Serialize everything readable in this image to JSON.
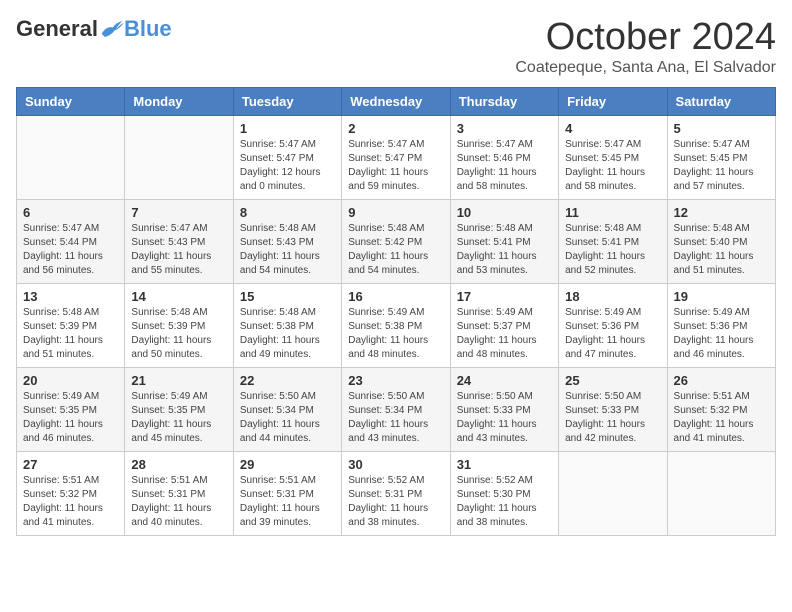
{
  "header": {
    "logo_general": "General",
    "logo_blue": "Blue",
    "month_title": "October 2024",
    "location": "Coatepeque, Santa Ana, El Salvador"
  },
  "days_of_week": [
    "Sunday",
    "Monday",
    "Tuesday",
    "Wednesday",
    "Thursday",
    "Friday",
    "Saturday"
  ],
  "weeks": [
    [
      {
        "day": "",
        "sunrise": "",
        "sunset": "",
        "daylight": ""
      },
      {
        "day": "",
        "sunrise": "",
        "sunset": "",
        "daylight": ""
      },
      {
        "day": "1",
        "sunrise": "Sunrise: 5:47 AM",
        "sunset": "Sunset: 5:47 PM",
        "daylight": "Daylight: 12 hours and 0 minutes."
      },
      {
        "day": "2",
        "sunrise": "Sunrise: 5:47 AM",
        "sunset": "Sunset: 5:47 PM",
        "daylight": "Daylight: 11 hours and 59 minutes."
      },
      {
        "day": "3",
        "sunrise": "Sunrise: 5:47 AM",
        "sunset": "Sunset: 5:46 PM",
        "daylight": "Daylight: 11 hours and 58 minutes."
      },
      {
        "day": "4",
        "sunrise": "Sunrise: 5:47 AM",
        "sunset": "Sunset: 5:45 PM",
        "daylight": "Daylight: 11 hours and 58 minutes."
      },
      {
        "day": "5",
        "sunrise": "Sunrise: 5:47 AM",
        "sunset": "Sunset: 5:45 PM",
        "daylight": "Daylight: 11 hours and 57 minutes."
      }
    ],
    [
      {
        "day": "6",
        "sunrise": "Sunrise: 5:47 AM",
        "sunset": "Sunset: 5:44 PM",
        "daylight": "Daylight: 11 hours and 56 minutes."
      },
      {
        "day": "7",
        "sunrise": "Sunrise: 5:47 AM",
        "sunset": "Sunset: 5:43 PM",
        "daylight": "Daylight: 11 hours and 55 minutes."
      },
      {
        "day": "8",
        "sunrise": "Sunrise: 5:48 AM",
        "sunset": "Sunset: 5:43 PM",
        "daylight": "Daylight: 11 hours and 54 minutes."
      },
      {
        "day": "9",
        "sunrise": "Sunrise: 5:48 AM",
        "sunset": "Sunset: 5:42 PM",
        "daylight": "Daylight: 11 hours and 54 minutes."
      },
      {
        "day": "10",
        "sunrise": "Sunrise: 5:48 AM",
        "sunset": "Sunset: 5:41 PM",
        "daylight": "Daylight: 11 hours and 53 minutes."
      },
      {
        "day": "11",
        "sunrise": "Sunrise: 5:48 AM",
        "sunset": "Sunset: 5:41 PM",
        "daylight": "Daylight: 11 hours and 52 minutes."
      },
      {
        "day": "12",
        "sunrise": "Sunrise: 5:48 AM",
        "sunset": "Sunset: 5:40 PM",
        "daylight": "Daylight: 11 hours and 51 minutes."
      }
    ],
    [
      {
        "day": "13",
        "sunrise": "Sunrise: 5:48 AM",
        "sunset": "Sunset: 5:39 PM",
        "daylight": "Daylight: 11 hours and 51 minutes."
      },
      {
        "day": "14",
        "sunrise": "Sunrise: 5:48 AM",
        "sunset": "Sunset: 5:39 PM",
        "daylight": "Daylight: 11 hours and 50 minutes."
      },
      {
        "day": "15",
        "sunrise": "Sunrise: 5:48 AM",
        "sunset": "Sunset: 5:38 PM",
        "daylight": "Daylight: 11 hours and 49 minutes."
      },
      {
        "day": "16",
        "sunrise": "Sunrise: 5:49 AM",
        "sunset": "Sunset: 5:38 PM",
        "daylight": "Daylight: 11 hours and 48 minutes."
      },
      {
        "day": "17",
        "sunrise": "Sunrise: 5:49 AM",
        "sunset": "Sunset: 5:37 PM",
        "daylight": "Daylight: 11 hours and 48 minutes."
      },
      {
        "day": "18",
        "sunrise": "Sunrise: 5:49 AM",
        "sunset": "Sunset: 5:36 PM",
        "daylight": "Daylight: 11 hours and 47 minutes."
      },
      {
        "day": "19",
        "sunrise": "Sunrise: 5:49 AM",
        "sunset": "Sunset: 5:36 PM",
        "daylight": "Daylight: 11 hours and 46 minutes."
      }
    ],
    [
      {
        "day": "20",
        "sunrise": "Sunrise: 5:49 AM",
        "sunset": "Sunset: 5:35 PM",
        "daylight": "Daylight: 11 hours and 46 minutes."
      },
      {
        "day": "21",
        "sunrise": "Sunrise: 5:49 AM",
        "sunset": "Sunset: 5:35 PM",
        "daylight": "Daylight: 11 hours and 45 minutes."
      },
      {
        "day": "22",
        "sunrise": "Sunrise: 5:50 AM",
        "sunset": "Sunset: 5:34 PM",
        "daylight": "Daylight: 11 hours and 44 minutes."
      },
      {
        "day": "23",
        "sunrise": "Sunrise: 5:50 AM",
        "sunset": "Sunset: 5:34 PM",
        "daylight": "Daylight: 11 hours and 43 minutes."
      },
      {
        "day": "24",
        "sunrise": "Sunrise: 5:50 AM",
        "sunset": "Sunset: 5:33 PM",
        "daylight": "Daylight: 11 hours and 43 minutes."
      },
      {
        "day": "25",
        "sunrise": "Sunrise: 5:50 AM",
        "sunset": "Sunset: 5:33 PM",
        "daylight": "Daylight: 11 hours and 42 minutes."
      },
      {
        "day": "26",
        "sunrise": "Sunrise: 5:51 AM",
        "sunset": "Sunset: 5:32 PM",
        "daylight": "Daylight: 11 hours and 41 minutes."
      }
    ],
    [
      {
        "day": "27",
        "sunrise": "Sunrise: 5:51 AM",
        "sunset": "Sunset: 5:32 PM",
        "daylight": "Daylight: 11 hours and 41 minutes."
      },
      {
        "day": "28",
        "sunrise": "Sunrise: 5:51 AM",
        "sunset": "Sunset: 5:31 PM",
        "daylight": "Daylight: 11 hours and 40 minutes."
      },
      {
        "day": "29",
        "sunrise": "Sunrise: 5:51 AM",
        "sunset": "Sunset: 5:31 PM",
        "daylight": "Daylight: 11 hours and 39 minutes."
      },
      {
        "day": "30",
        "sunrise": "Sunrise: 5:52 AM",
        "sunset": "Sunset: 5:31 PM",
        "daylight": "Daylight: 11 hours and 38 minutes."
      },
      {
        "day": "31",
        "sunrise": "Sunrise: 5:52 AM",
        "sunset": "Sunset: 5:30 PM",
        "daylight": "Daylight: 11 hours and 38 minutes."
      },
      {
        "day": "",
        "sunrise": "",
        "sunset": "",
        "daylight": ""
      },
      {
        "day": "",
        "sunrise": "",
        "sunset": "",
        "daylight": ""
      }
    ]
  ]
}
